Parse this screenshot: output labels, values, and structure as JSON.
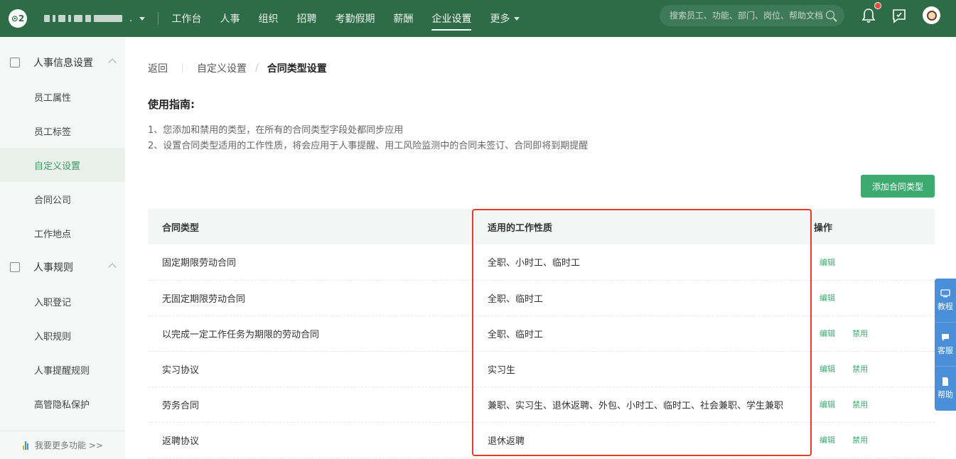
{
  "topbar": {
    "logo": "⊙2",
    "company_suffix": ".",
    "nav": [
      {
        "label": "工作台",
        "active": false
      },
      {
        "label": "人事",
        "active": false
      },
      {
        "label": "组织",
        "active": false
      },
      {
        "label": "招聘",
        "active": false
      },
      {
        "label": "考勤假期",
        "active": false
      },
      {
        "label": "薪酬",
        "active": false
      },
      {
        "label": "企业设置",
        "active": true
      },
      {
        "label": "更多",
        "active": false
      }
    ],
    "search_placeholder": "搜索员工、功能、部门、岗位、帮助文档",
    "colors": {
      "bar": "#2e6b47",
      "notification_dot": "#f04a3e"
    }
  },
  "sidebar": {
    "section1": {
      "label": "人事信息设置",
      "icon": "id-card-icon"
    },
    "section1_items": [
      "员工属性",
      "员工标签",
      "自定义设置",
      "合同公司",
      "工作地点"
    ],
    "active_item": "自定义设置",
    "section2": {
      "label": "人事规则",
      "icon": "rule-icon"
    },
    "section2_items": [
      "入职登记",
      "入职规则",
      "人事提醒规则",
      "高管隐私保护"
    ],
    "footer": "我要更多功能 >>"
  },
  "breadcrumb": {
    "back": "返回",
    "parent": "自定义设置",
    "separator": "/",
    "current": "合同类型设置"
  },
  "guide": {
    "title": "使用指南:",
    "lines": [
      "1、您添加和禁用的类型，在所有的合同类型字段处都同步应用",
      "2、设置合同类型适用的工作性质，将会应用于人事提醒、用工风险监测中的合同未签订、合同即将到期提醒"
    ]
  },
  "add_button": "添加合同类型",
  "table": {
    "headers": [
      "合同类型",
      "适用的工作性质",
      "操作"
    ],
    "rows": [
      {
        "type": "固定期限劳动合同",
        "nature": "全职、小时工、临时工",
        "ops": [
          "编辑"
        ]
      },
      {
        "type": "无固定期限劳动合同",
        "nature": "全职、临时工",
        "ops": [
          "编辑"
        ]
      },
      {
        "type": "以完成一定工作任务为期限的劳动合同",
        "nature": "全职、临时工",
        "ops": [
          "编辑",
          "禁用"
        ]
      },
      {
        "type": "实习协议",
        "nature": "实习生",
        "ops": [
          "编辑",
          "禁用"
        ]
      },
      {
        "type": "劳务合同",
        "nature": "兼职、实习生、退休返聘、外包、小时工、临时工、社会兼职、学生兼职",
        "ops": [
          "编辑",
          "禁用"
        ]
      },
      {
        "type": "返聘协议",
        "nature": "退休返聘",
        "ops": [
          "编辑",
          "禁用"
        ]
      }
    ]
  },
  "float_panel": [
    "教程",
    "客服",
    "帮助"
  ],
  "accent_color": "#3dab6f",
  "highlight_color": "#e33b2e"
}
